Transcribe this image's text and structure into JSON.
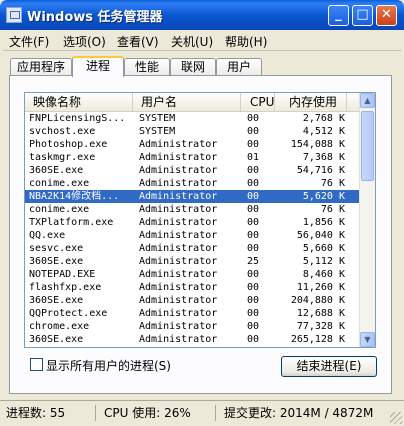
{
  "window": {
    "title": "Windows 任务管理器",
    "btn_min": "_",
    "btn_max": "□",
    "btn_close": "✕"
  },
  "menu": [
    "文件(F)",
    "选项(O)",
    "查看(V)",
    "关机(U)",
    "帮助(H)"
  ],
  "tabs": [
    "应用程序",
    "进程",
    "性能",
    "联网",
    "用户"
  ],
  "active_tab": "进程",
  "columns": [
    "映像名称",
    "用户名",
    "CPU",
    "内存使用"
  ],
  "rows": [
    [
      "FNPLicensingS...",
      "SYSTEM",
      "00",
      "2,768 K"
    ],
    [
      "svchost.exe",
      "SYSTEM",
      "00",
      "4,512 K"
    ],
    [
      "Photoshop.exe",
      "Administrator",
      "00",
      "154,088 K"
    ],
    [
      "taskmgr.exe",
      "Administrator",
      "01",
      "7,368 K"
    ],
    [
      "360SE.exe",
      "Administrator",
      "00",
      "54,716 K"
    ],
    [
      "conime.exe",
      "Administrator",
      "00",
      "76 K"
    ],
    [
      "NBA2K14修改档...",
      "Administrator",
      "00",
      "5,620 K"
    ],
    [
      "conime.exe",
      "Administrator",
      "00",
      "76 K"
    ],
    [
      "TXPlatform.exe",
      "Administrator",
      "00",
      "1,856 K"
    ],
    [
      "QQ.exe",
      "Administrator",
      "00",
      "56,040 K"
    ],
    [
      "sesvc.exe",
      "Administrator",
      "00",
      "5,660 K"
    ],
    [
      "360SE.exe",
      "Administrator",
      "25",
      "5,112 K"
    ],
    [
      "NOTEPAD.EXE",
      "Administrator",
      "00",
      "8,460 K"
    ],
    [
      "flashfxp.exe",
      "Administrator",
      "00",
      "11,260 K"
    ],
    [
      "360SE.exe",
      "Administrator",
      "00",
      "204,880 K"
    ],
    [
      "QQProtect.exe",
      "Administrator",
      "00",
      "12,688 K"
    ],
    [
      "chrome.exe",
      "Administrator",
      "00",
      "77,328 K"
    ],
    [
      "360SE.exe",
      "Administrator",
      "00",
      "265,128 K"
    ]
  ],
  "selected_row": 6,
  "colors": {
    "selection": "#316ac5",
    "titlebar": "#0b57d0"
  },
  "show_all_users": {
    "label": "显示所有用户的进程(S)",
    "checked": false
  },
  "end_process_label": "结束进程(E)",
  "status": {
    "processes": "进程数: 55",
    "cpu": "CPU 使用: 26%",
    "commit": "提交更改: 2014M / 4872M"
  }
}
